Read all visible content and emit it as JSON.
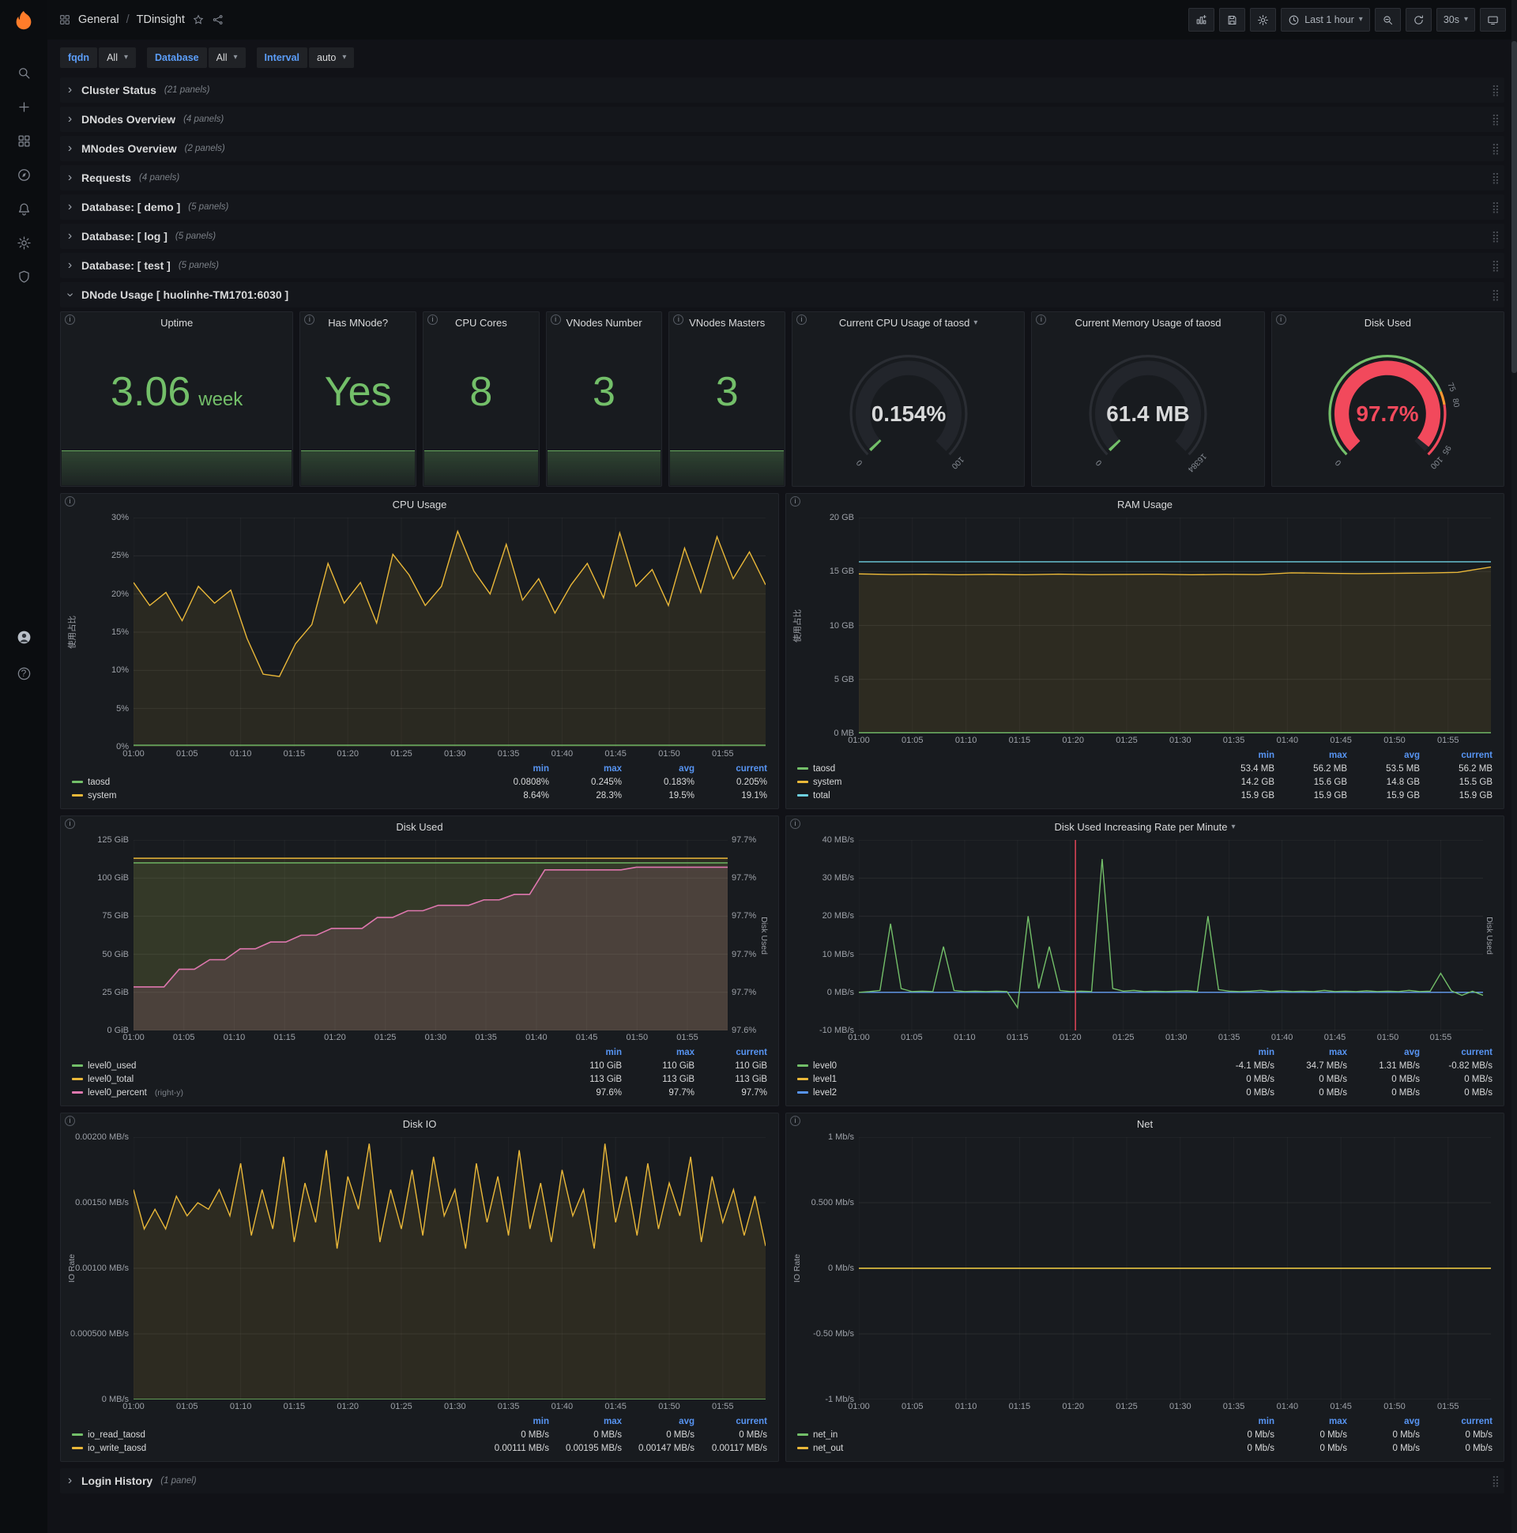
{
  "nav": {
    "section": "General",
    "separator": "/",
    "title": "TDinsight",
    "time_range": "Last 1 hour",
    "refresh": "30s"
  },
  "icons": {
    "chevron": "›",
    "caret_down": "▾",
    "drag_handle": "⣿",
    "info": "i",
    "help": "?"
  },
  "variables": [
    {
      "label": "fqdn",
      "value": "All"
    },
    {
      "label": "Database",
      "value": "All"
    },
    {
      "label": "Interval",
      "value": "auto"
    }
  ],
  "rows": [
    {
      "title": "Cluster Status",
      "count": "(21 panels)"
    },
    {
      "title": "DNodes Overview",
      "count": "(4 panels)"
    },
    {
      "title": "MNodes Overview",
      "count": "(2 panels)"
    },
    {
      "title": "Requests",
      "count": "(4 panels)"
    },
    {
      "title": "Database: [ demo ]",
      "count": "(5 panels)"
    },
    {
      "title": "Database: [ log ]",
      "count": "(5 panels)"
    },
    {
      "title": "Database: [ test ]",
      "count": "(5 panels)"
    }
  ],
  "dnode_row": {
    "title": "DNode Usage [ huolinhe-TM1701:6030 ]"
  },
  "login_row": {
    "title": "Login History",
    "count": "(1 panel)"
  },
  "colors": {
    "green": "#73bf69",
    "yellow": "#eab839",
    "blue": "#5794f2",
    "cyan": "#6ed0e0",
    "red": "#f2495c",
    "pink": "#de77ae"
  },
  "stats": [
    {
      "title": "Uptime",
      "value": "3.06",
      "unit": "week"
    },
    {
      "title": "Has MNode?",
      "value": "Yes",
      "unit": ""
    },
    {
      "title": "CPU Cores",
      "value": "8",
      "unit": ""
    },
    {
      "title": "VNodes Number",
      "value": "3",
      "unit": ""
    },
    {
      "title": "VNodes Masters",
      "value": "3",
      "unit": ""
    }
  ],
  "gauges": [
    {
      "title": "Current CPU Usage of taosd",
      "dropdown": true,
      "value": "0.154%",
      "pct": 0.00154,
      "min_label": "0",
      "max_label": "100",
      "color": "#73bf69",
      "value_color": "#d8d9da",
      "ring": [
        {
          "from": 0,
          "to": 1,
          "color": "#2a2d33"
        }
      ]
    },
    {
      "title": "Current Memory Usage of taosd",
      "dropdown": false,
      "value": "61.4 MB",
      "pct": 0.0037,
      "min_label": "0",
      "max_label": "16384",
      "color": "#73bf69",
      "value_color": "#d8d9da",
      "ring": [
        {
          "from": 0,
          "to": 1,
          "color": "#2a2d33"
        }
      ]
    },
    {
      "title": "Disk Used",
      "dropdown": false,
      "value": "97.7%",
      "pct": 0.977,
      "min_label": "0",
      "max_label": "",
      "color": "#f2495c",
      "value_color": "#f2495c",
      "ring": [
        {
          "from": 0,
          "to": 0.75,
          "color": "#73bf69"
        },
        {
          "from": 0.75,
          "to": 0.8,
          "color": "#ff9830"
        },
        {
          "from": 0.8,
          "to": 1,
          "color": "#f2495c"
        }
      ],
      "thresholds": [
        {
          "pct": 0.75,
          "label": "75"
        },
        {
          "pct": 0.8,
          "label": "80"
        },
        {
          "pct": 0.95,
          "label": "95"
        },
        {
          "pct": 1,
          "label": "100"
        }
      ]
    }
  ],
  "xticks": [
    "01:00",
    "01:05",
    "01:10",
    "01:15",
    "01:20",
    "01:25",
    "01:30",
    "01:35",
    "01:40",
    "01:45",
    "01:50",
    "01:55"
  ],
  "charts": [
    {
      "id": "cpu-usage",
      "title": "CPU Usage",
      "dropdown": false,
      "type": "line",
      "ylabel": "使用占比",
      "ymin": 0,
      "ymax": 30,
      "yticks": [
        {
          "label": "30%",
          "v": 30
        },
        {
          "label": "25%",
          "v": 25
        },
        {
          "label": "20%",
          "v": 20
        },
        {
          "label": "15%",
          "v": 15
        },
        {
          "label": "10%",
          "v": 10
        },
        {
          "label": "5%",
          "v": 5
        },
        {
          "label": "0%",
          "v": 0
        }
      ],
      "series": [
        {
          "name": "system",
          "color": "#eab839",
          "fill": "rgba(234,184,57,0.09)",
          "values": [
            21.5,
            18.5,
            20.2,
            16.5,
            21.0,
            18.8,
            20.5,
            14.2,
            9.5,
            9.2,
            13.5,
            16.0,
            24.0,
            18.8,
            21.5,
            16.2,
            25.2,
            22.5,
            18.5,
            21.0,
            28.2,
            23.0,
            20.0,
            26.5,
            19.2,
            22.0,
            17.5,
            21.2,
            24.0,
            19.5,
            28.0,
            21.0,
            23.2,
            18.5,
            26.0,
            20.2,
            27.5,
            22.0,
            25.5,
            21.2
          ]
        },
        {
          "name": "taosd",
          "color": "#73bf69",
          "values": [
            0.2,
            0.2
          ]
        }
      ],
      "legend": {
        "cols": [
          "min",
          "max",
          "avg",
          "current"
        ],
        "rows": [
          {
            "name": "taosd",
            "color": "#73bf69",
            "values": [
              "0.0808%",
              "0.245%",
              "0.183%",
              "0.205%"
            ]
          },
          {
            "name": "system",
            "color": "#eab839",
            "values": [
              "8.64%",
              "28.3%",
              "19.5%",
              "19.1%"
            ]
          }
        ]
      }
    },
    {
      "id": "ram-usage",
      "title": "RAM Usage",
      "dropdown": false,
      "type": "line",
      "ylabel": "使用占比",
      "ymin": 0,
      "ymax": 20,
      "yticks": [
        {
          "label": "20 GB",
          "v": 20
        },
        {
          "label": "15 GB",
          "v": 15
        },
        {
          "label": "10 GB",
          "v": 10
        },
        {
          "label": "5 GB",
          "v": 5
        },
        {
          "label": "0 MB",
          "v": 0
        }
      ],
      "series": [
        {
          "name": "system",
          "color": "#eab839",
          "fill": "rgba(234,184,57,0.10)",
          "values": [
            14.78,
            14.72,
            14.75,
            14.7,
            14.74,
            14.7,
            14.76,
            14.71,
            14.73,
            14.75,
            14.7,
            14.74,
            14.72,
            14.88,
            14.84,
            14.8,
            14.83,
            14.86,
            14.92,
            15.42
          ]
        },
        {
          "name": "total",
          "color": "#6ed0e0",
          "values": [
            15.9,
            15.9
          ]
        },
        {
          "name": "taosd",
          "color": "#73bf69",
          "values": [
            0.055,
            0.055
          ]
        }
      ],
      "legend": {
        "cols": [
          "min",
          "max",
          "avg",
          "current"
        ],
        "rows": [
          {
            "name": "taosd",
            "color": "#73bf69",
            "values": [
              "53.4 MB",
              "56.2 MB",
              "53.5 MB",
              "56.2 MB"
            ]
          },
          {
            "name": "system",
            "color": "#eab839",
            "values": [
              "14.2 GB",
              "15.6 GB",
              "14.8 GB",
              "15.5 GB"
            ]
          },
          {
            "name": "total",
            "color": "#6ed0e0",
            "values": [
              "15.9 GB",
              "15.9 GB",
              "15.9 GB",
              "15.9 GB"
            ]
          }
        ]
      }
    },
    {
      "id": "disk-used",
      "title": "Disk Used",
      "dropdown": false,
      "type": "line",
      "ylabel": "",
      "rlabel": "Disk Used",
      "ymin": 0,
      "ymax": 125,
      "yticks": [
        {
          "label": "125 GiB",
          "v": 125
        },
        {
          "label": "100 GiB",
          "v": 100
        },
        {
          "label": "75 GiB",
          "v": 75
        },
        {
          "label": "50 GiB",
          "v": 50
        },
        {
          "label": "25 GiB",
          "v": 25
        },
        {
          "label": "0 GiB",
          "v": 0
        }
      ],
      "rticks": [
        {
          "label": "97.7%",
          "f": 0
        },
        {
          "label": "97.7%",
          "f": 0.2
        },
        {
          "label": "97.7%",
          "f": 0.4
        },
        {
          "label": "97.7%",
          "f": 0.6
        },
        {
          "label": "97.7%",
          "f": 0.8
        },
        {
          "label": "97.6%",
          "f": 1
        }
      ],
      "series": [
        {
          "name": "level0_total",
          "color": "#eab839",
          "fill": "rgba(234,184,57,0.10)",
          "values": [
            113,
            113
          ]
        },
        {
          "name": "level0_used",
          "color": "#73bf69",
          "fill": "rgba(115,191,105,0.10)",
          "values": [
            110,
            110
          ]
        },
        {
          "name": "level0_percent",
          "color": "#de77ae",
          "w": 1.6,
          "fill": "rgba(222,119,174,0.14)",
          "ymin": 97.58,
          "ymax": 97.72,
          "values": [
            97.612,
            97.612,
            97.612,
            97.625,
            97.625,
            97.632,
            97.632,
            97.64,
            97.64,
            97.645,
            97.645,
            97.65,
            97.65,
            97.655,
            97.655,
            97.655,
            97.663,
            97.663,
            97.668,
            97.668,
            97.672,
            97.672,
            97.672,
            97.676,
            97.676,
            97.68,
            97.68,
            97.698,
            97.698,
            97.698,
            97.698,
            97.698,
            97.698,
            97.7,
            97.7,
            97.7,
            97.7,
            97.7,
            97.7,
            97.7
          ]
        }
      ],
      "legend": {
        "cols": [
          "min",
          "max",
          "current"
        ],
        "rows": [
          {
            "name": "level0_used",
            "color": "#73bf69",
            "values": [
              "110 GiB",
              "110 GiB",
              "110 GiB"
            ]
          },
          {
            "name": "level0_total",
            "color": "#eab839",
            "values": [
              "113 GiB",
              "113 GiB",
              "113 GiB"
            ]
          },
          {
            "name": "level0_percent",
            "color": "#de77ae",
            "suffix": "(right-y)",
            "values": [
              "97.6%",
              "97.7%",
              "97.7%"
            ]
          }
        ]
      }
    },
    {
      "id": "disk-rate",
      "title": "Disk Used Increasing Rate per Minute",
      "dropdown": true,
      "type": "line",
      "ylabel": "",
      "rlabel": "Disk Used",
      "ymin": -10,
      "ymax": 40,
      "yticks": [
        {
          "label": "40 MB/s",
          "v": 40
        },
        {
          "label": "30 MB/s",
          "v": 30
        },
        {
          "label": "20 MB/s",
          "v": 20
        },
        {
          "label": "10 MB/s",
          "v": 10
        },
        {
          "label": "0 MB/s",
          "v": 0
        },
        {
          "label": "-10 MB/s",
          "v": -10
        }
      ],
      "annotation": {
        "x": 0.347,
        "color": "#f2495c"
      },
      "series": [
        {
          "name": "level1",
          "color": "#eab839",
          "values": [
            0,
            0
          ]
        },
        {
          "name": "level2",
          "color": "#5794f2",
          "values": [
            0,
            0
          ]
        },
        {
          "name": "level0",
          "color": "#73bf69",
          "values": [
            0,
            0.2,
            0.5,
            18,
            1,
            0.2,
            0.3,
            0.2,
            12,
            0.5,
            0.2,
            0.3,
            0.2,
            0.3,
            0.2,
            -4,
            20,
            1,
            12,
            0.5,
            0.2,
            0.3,
            0.2,
            35,
            1,
            0.3,
            0.5,
            0.2,
            0.3,
            0.2,
            0.3,
            0.4,
            0.2,
            20,
            0.7,
            0.3,
            0.2,
            0.3,
            0.5,
            0.2,
            0.4,
            0.2,
            0.3,
            0.2,
            0.5,
            0.2,
            0.3,
            0.2,
            0.4,
            0.2,
            0.3,
            0.2,
            0.5,
            0.2,
            0.3,
            5,
            0.4,
            -0.8,
            0.3,
            -0.8
          ]
        }
      ],
      "legend": {
        "cols": [
          "min",
          "max",
          "avg",
          "current"
        ],
        "rows": [
          {
            "name": "level0",
            "color": "#73bf69",
            "values": [
              "-4.1 MB/s",
              "34.7 MB/s",
              "1.31 MB/s",
              "-0.82 MB/s"
            ]
          },
          {
            "name": "level1",
            "color": "#eab839",
            "values": [
              "0 MB/s",
              "0 MB/s",
              "0 MB/s",
              "0 MB/s"
            ]
          },
          {
            "name": "level2",
            "color": "#5794f2",
            "values": [
              "0 MB/s",
              "0 MB/s",
              "0 MB/s",
              "0 MB/s"
            ]
          }
        ]
      }
    },
    {
      "id": "disk-io",
      "title": "Disk IO",
      "dropdown": false,
      "type": "line",
      "ylabel": "IO Rate",
      "ymin": 0,
      "ymax": 0.002,
      "yticks": [
        {
          "label": "0.00200 MB/s",
          "v": 0.002
        },
        {
          "label": "0.00150 MB/s",
          "v": 0.0015
        },
        {
          "label": "0.00100 MB/s",
          "v": 0.001
        },
        {
          "label": "0.000500 MB/s",
          "v": 0.0005
        },
        {
          "label": "0 MB/s",
          "v": 0
        }
      ],
      "series": [
        {
          "name": "io_write_taosd",
          "color": "#eab839",
          "fill": "rgba(234,184,57,0.10)",
          "values": [
            0.0016,
            0.0013,
            0.00145,
            0.0013,
            0.00155,
            0.0014,
            0.0015,
            0.00145,
            0.0016,
            0.0014,
            0.0018,
            0.00125,
            0.0016,
            0.0013,
            0.00185,
            0.0012,
            0.00165,
            0.00135,
            0.0019,
            0.00115,
            0.0017,
            0.00145,
            0.00195,
            0.0012,
            0.0016,
            0.0013,
            0.00175,
            0.00125,
            0.00185,
            0.0014,
            0.0016,
            0.00115,
            0.0018,
            0.00135,
            0.0017,
            0.00125,
            0.0019,
            0.0013,
            0.00165,
            0.0012,
            0.00175,
            0.0014,
            0.0016,
            0.00115,
            0.00195,
            0.00135,
            0.0017,
            0.00125,
            0.0018,
            0.0013,
            0.00165,
            0.0014,
            0.00185,
            0.0012,
            0.0017,
            0.00135,
            0.0016,
            0.00125,
            0.00155,
            0.00117
          ]
        },
        {
          "name": "io_read_taosd",
          "color": "#73bf69",
          "values": [
            0,
            0
          ]
        }
      ],
      "legend": {
        "cols": [
          "min",
          "max",
          "avg",
          "current"
        ],
        "rows": [
          {
            "name": "io_read_taosd",
            "color": "#73bf69",
            "values": [
              "0 MB/s",
              "0 MB/s",
              "0 MB/s",
              "0 MB/s"
            ]
          },
          {
            "name": "io_write_taosd",
            "color": "#eab839",
            "values": [
              "0.00111 MB/s",
              "0.00195 MB/s",
              "0.00147 MB/s",
              "0.00117 MB/s"
            ]
          }
        ]
      }
    },
    {
      "id": "net",
      "title": "Net",
      "dropdown": false,
      "type": "line",
      "ylabel": "IO Rate",
      "ymin": -1,
      "ymax": 1,
      "yticks": [
        {
          "label": "1 Mb/s",
          "v": 1
        },
        {
          "label": "0.500 Mb/s",
          "v": 0.5
        },
        {
          "label": "0 Mb/s",
          "v": 0
        },
        {
          "label": "-0.50 Mb/s",
          "v": -0.5
        },
        {
          "label": "-1 Mb/s",
          "v": -1
        }
      ],
      "series": [
        {
          "name": "net_in",
          "color": "#73bf69",
          "values": [
            0,
            0
          ]
        },
        {
          "name": "net_out",
          "color": "#eab839",
          "values": [
            0,
            0
          ]
        }
      ],
      "legend": {
        "cols": [
          "min",
          "max",
          "avg",
          "current"
        ],
        "rows": [
          {
            "name": "net_in",
            "color": "#73bf69",
            "values": [
              "0 Mb/s",
              "0 Mb/s",
              "0 Mb/s",
              "0 Mb/s"
            ]
          },
          {
            "name": "net_out",
            "color": "#eab839",
            "values": [
              "0 Mb/s",
              "0 Mb/s",
              "0 Mb/s",
              "0 Mb/s"
            ]
          }
        ]
      }
    }
  ]
}
